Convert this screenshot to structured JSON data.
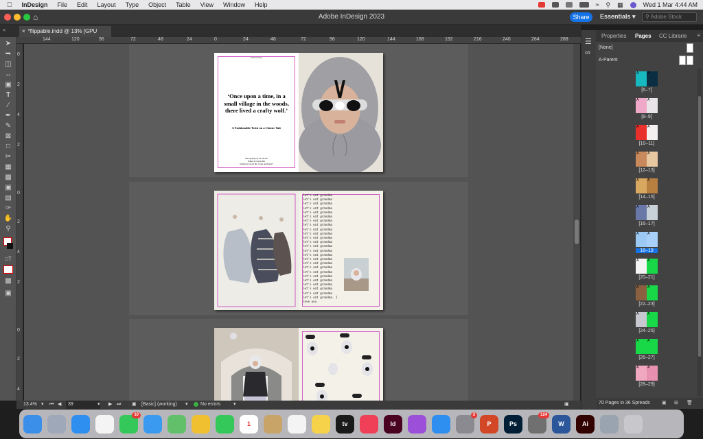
{
  "menubar": {
    "app": "InDesign",
    "items": [
      "File",
      "Edit",
      "Layout",
      "Type",
      "Object",
      "Table",
      "View",
      "Window",
      "Help"
    ],
    "clock": "Wed 1 Mar  4:44 AM"
  },
  "titlebar": {
    "title": "Adobe InDesign 2023",
    "share": "Share",
    "workspace": "Essentials",
    "stock_placeholder": "Adobe Stock"
  },
  "document_tab": {
    "label": "*flippable.indd @ 13% [GPU Preview]"
  },
  "ruler_h": [
    "144",
    "120",
    "96",
    "72",
    "48",
    "24",
    "0",
    "24",
    "48",
    "72",
    "96",
    "120",
    "144",
    "168",
    "192",
    "216",
    "240",
    "264",
    "288"
  ],
  "ruler_v": [
    "0",
    "2",
    "4",
    "2",
    "0",
    "2",
    "4",
    "2",
    "0",
    "2",
    "4"
  ],
  "spread1": {
    "header": "Fashion Inspo",
    "quote": "‘Once upon a time, in a small village in the woods, there lived a crafty wolf.’",
    "subtitle": "A Fashionable Twist on a Classic Tale",
    "credit_1": "Photography by Gloria Ma",
    "credit_2": "Edited by Gloria Ma",
    "credit_3": "Styling by Gloria Ma, Crane and Intern*"
  },
  "spread2": {
    "handwriting_line": "let's eat grandma",
    "handwriting_last": "let's eat grandma. I love you"
  },
  "statusbar": {
    "zoom": "13.4%",
    "page": "39",
    "style": "[Basic] (working)",
    "errors": "No errors"
  },
  "panel": {
    "tabs": [
      "Properties",
      "Pages",
      "CC Librarie"
    ],
    "none_label": "[None]",
    "parent_label": "A-Parent",
    "pages": [
      {
        "label": "[6–7]",
        "colors": [
          "#18b8c0",
          "#0a2f42"
        ]
      },
      {
        "label": "[8–9]",
        "colors": [
          "#f0a8c8",
          "#e8e4e8"
        ]
      },
      {
        "label": "[10–11]",
        "colors": [
          "#e8302c",
          "#f4f0f0"
        ]
      },
      {
        "label": "[12–13]",
        "colors": [
          "#c88a5c",
          "#e8c8a0"
        ]
      },
      {
        "label": "[14–15]",
        "colors": [
          "#d8a860",
          "#b88040"
        ]
      },
      {
        "label": "[16–17]",
        "colors": [
          "#6a78a8",
          "#c8d0d8"
        ]
      },
      {
        "label": "18–19",
        "colors": [
          "#9cc8f4",
          "#a8d0f8"
        ],
        "selected": true
      },
      {
        "label": "[20–21]",
        "colors": [
          "#f4f4f4",
          "#18d848"
        ]
      },
      {
        "label": "[22–23]",
        "colors": [
          "#8a6040",
          "#18d848"
        ]
      },
      {
        "label": "[24–25]",
        "colors": [
          "#c8c8d0",
          "#18d848"
        ]
      },
      {
        "label": "[26–27]",
        "colors": [
          "#18d848",
          "#18d848"
        ]
      },
      {
        "label": "[28–29]",
        "colors": [
          "#f0a8c0",
          "#e890b0"
        ]
      }
    ],
    "footer": "70 Pages in 36 Spreads"
  },
  "dock": [
    {
      "name": "Finder",
      "color": "#3b8fe8"
    },
    {
      "name": "Launchpad",
      "color": "#9ea8b8"
    },
    {
      "name": "Safari",
      "color": "#2f8ff0"
    },
    {
      "name": "Chrome",
      "color": "#f4f4f4"
    },
    {
      "name": "Messages",
      "color": "#34c759",
      "badge": "10"
    },
    {
      "name": "Mail",
      "color": "#3a9af0"
    },
    {
      "name": "Maps",
      "color": "#62c06a"
    },
    {
      "name": "Photos",
      "color": "#f0c030"
    },
    {
      "name": "FaceTime",
      "color": "#34c759"
    },
    {
      "name": "Calendar",
      "color": "#ffffff",
      "text": "1"
    },
    {
      "name": "Notes",
      "color": "#c8a468"
    },
    {
      "name": "Reminders",
      "color": "#f4f4f4"
    },
    {
      "name": "Stickies",
      "color": "#f6d24a"
    },
    {
      "name": "TV",
      "color": "#1a1a1a",
      "text": "tv"
    },
    {
      "name": "Music",
      "color": "#f04058"
    },
    {
      "name": "InDesign",
      "color": "#49021f",
      "text": "Id"
    },
    {
      "name": "Podcasts",
      "color": "#9c4fd8"
    },
    {
      "name": "App Store",
      "color": "#2f8ff0"
    },
    {
      "name": "System Settings",
      "color": "#8a8a90",
      "badge": "3"
    },
    {
      "name": "PowerPoint",
      "color": "#d24726",
      "text": "P"
    },
    {
      "name": "Photoshop",
      "color": "#001e36",
      "text": "Ps"
    },
    {
      "name": "Printer",
      "color": "#707070",
      "badge": "124"
    },
    {
      "name": "Word",
      "color": "#2b579a",
      "text": "W"
    },
    {
      "name": "Illustrator",
      "color": "#330000",
      "text": "Ai"
    },
    {
      "name": "Preview",
      "color": "#9aa4b0"
    },
    {
      "name": "Trash",
      "color": "#c8c8cc"
    }
  ]
}
